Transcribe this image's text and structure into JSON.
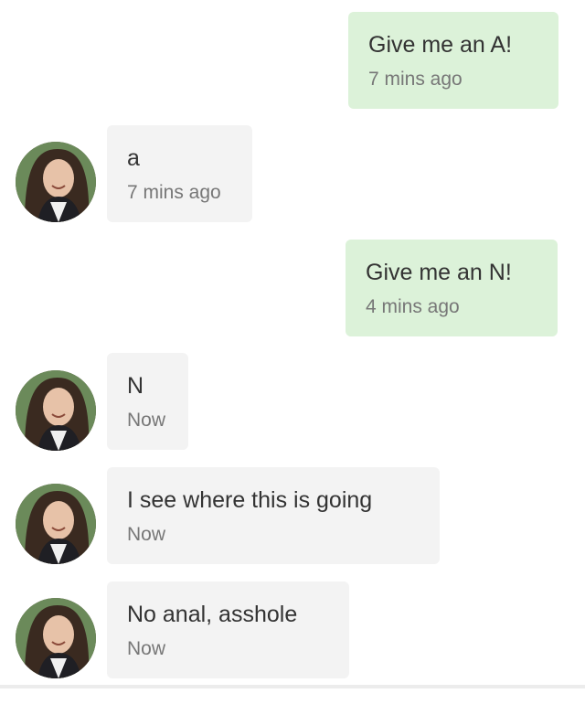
{
  "messages": [
    {
      "direction": "outgoing",
      "text": "Give me an A!",
      "time": "7 mins ago"
    },
    {
      "direction": "incoming",
      "text": "a",
      "time": "7 mins ago"
    },
    {
      "direction": "outgoing",
      "text": "Give me an N!",
      "time": "4 mins ago"
    },
    {
      "direction": "incoming",
      "text": "N",
      "time": "Now"
    },
    {
      "direction": "incoming",
      "text": "I see where this is going",
      "time": "Now"
    },
    {
      "direction": "incoming",
      "text": "No anal, asshole",
      "time": "Now"
    }
  ],
  "colors": {
    "outgoing_bubble": "#dcf2d9",
    "incoming_bubble": "#f3f3f3",
    "text": "#333333",
    "timestamp": "#777777"
  },
  "icons": {
    "contact_avatar": "avatar-icon"
  }
}
